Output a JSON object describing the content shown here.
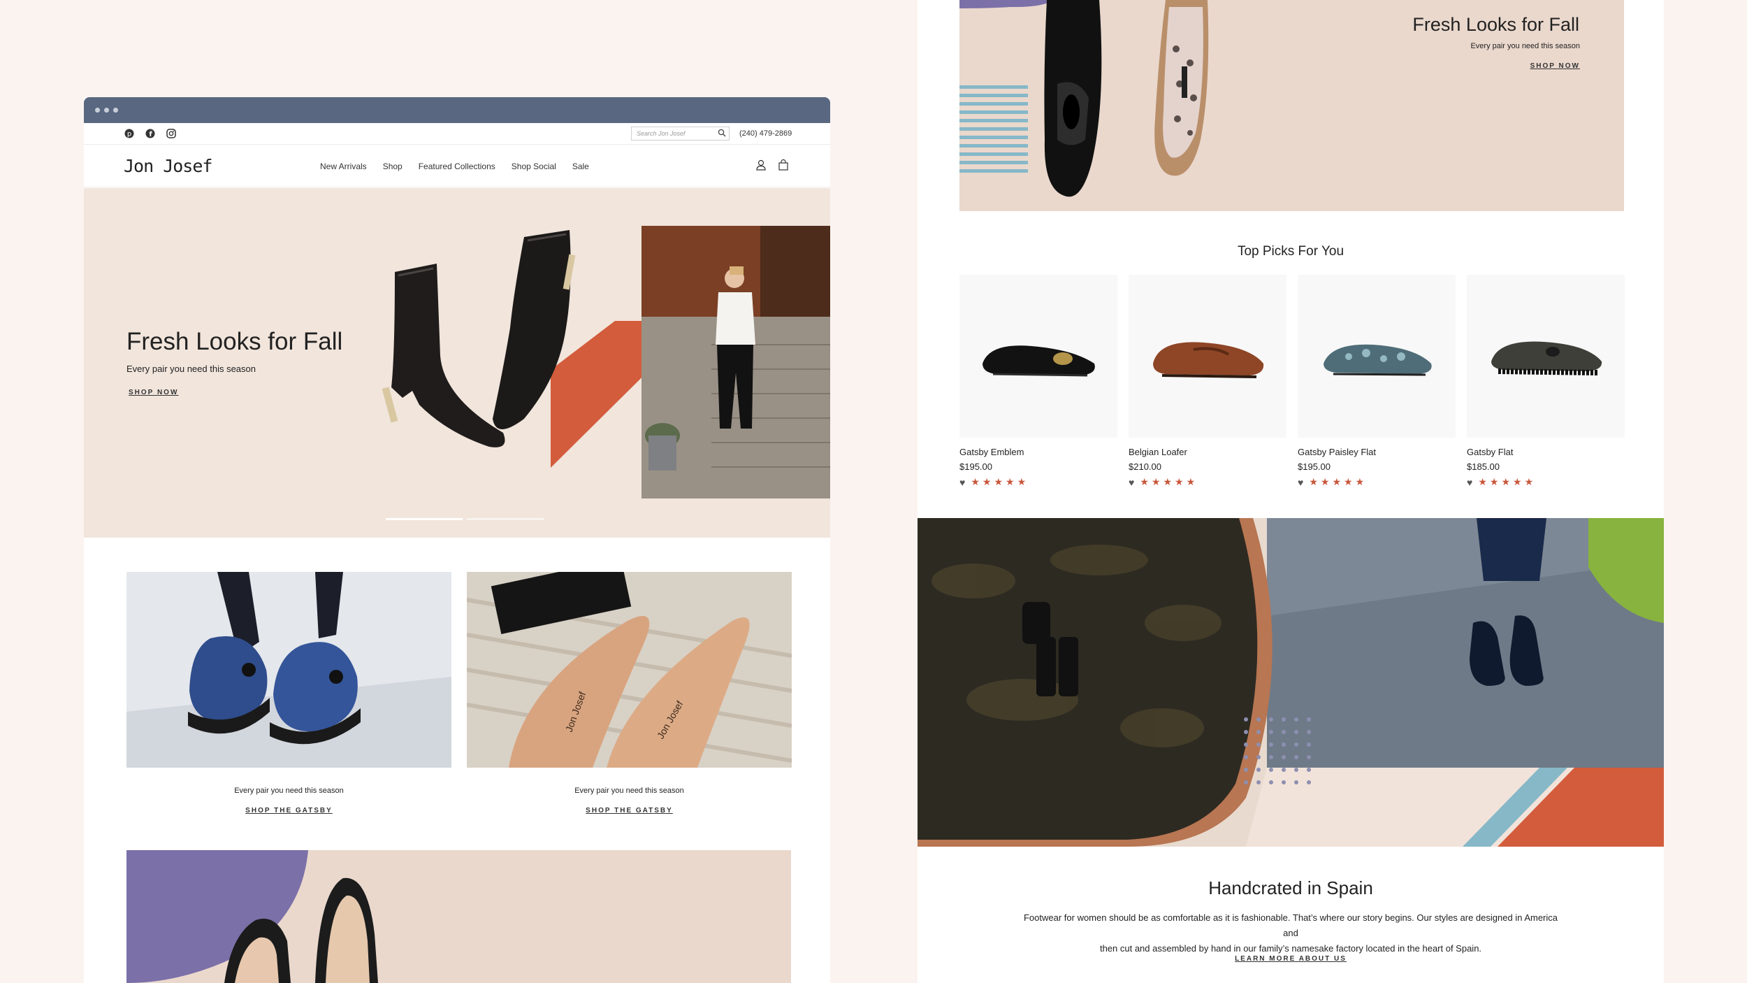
{
  "left": {
    "header": {
      "social_icons": [
        "pinterest-icon",
        "facebook-icon",
        "instagram-icon"
      ],
      "search_placeholder": "Search Jon Josef",
      "phone": "(240) 479-2869",
      "logo": "Jon Josef",
      "nav": [
        "New Arrivals",
        "Shop",
        "Featured Collections",
        "Shop Social",
        "Sale"
      ],
      "icons": [
        "account-icon",
        "cart-icon"
      ]
    },
    "hero": {
      "title": "Fresh Looks for Fall",
      "subtitle": "Every pair you need this season",
      "cta": "SHOP NOW",
      "accent_color": "#d35c3c",
      "background": "#f1e5dc"
    },
    "promos": [
      {
        "caption": "Every pair you need this season",
        "cta": "SHOP THE GATSBY"
      },
      {
        "caption": "Every pair you need this season",
        "cta": "SHOP THE GATSBY"
      }
    ],
    "banner_text": [
      "Jon Josef",
      "Jon Josef"
    ]
  },
  "right": {
    "banner": {
      "title": "Fresh Looks for Fall",
      "subtitle": "Every pair you need this season",
      "cta": "SHOP NOW",
      "purple": "#7b70a8",
      "teal": "#86b8c8"
    },
    "top_picks": {
      "title": "Top Picks For You",
      "products": [
        {
          "name": "Gatsby Emblem",
          "price": "$195.00",
          "rating": 5
        },
        {
          "name": "Belgian Loafer",
          "price": "$210.00",
          "rating": 5
        },
        {
          "name": "Gatsby Paisley Flat",
          "price": "$195.00",
          "rating": 5
        },
        {
          "name": "Gatsby Flat",
          "price": "$185.00",
          "rating": 5
        }
      ]
    },
    "about": {
      "title": "Handcrated in Spain",
      "body_line1": "Footwear for women should be as comfortable as it is fashionable. That’s where our story begins. Our styles are designed in America and",
      "body_line2": "then cut and assembled by hand in our family’s namesake factory located in the heart of Spain.",
      "cta": "LEARN MORE ABOUT US"
    },
    "star_color": "#c9573c"
  }
}
